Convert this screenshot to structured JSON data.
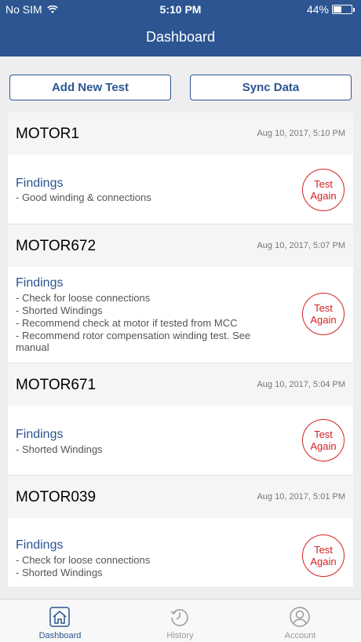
{
  "status": {
    "carrier": "No SIM",
    "time": "5:10 PM",
    "battery": "44%",
    "battery_level": 0.44
  },
  "header": {
    "title": "Dashboard"
  },
  "actions": {
    "add_label": "Add New Test",
    "sync_label": "Sync Data"
  },
  "findings_label": "Findings",
  "test_again": [
    "Test",
    "Again"
  ],
  "motors": [
    {
      "name": "MOTOR1",
      "date": "Aug 10, 2017, 5:10 PM",
      "findings": [
        "- Good winding & connections"
      ]
    },
    {
      "name": "MOTOR672",
      "date": "Aug 10, 2017, 5:07 PM",
      "findings": [
        "- Check for loose connections",
        "- Shorted Windings",
        "- Recommend check at motor if tested from MCC",
        "- Recommend rotor compensation winding test. See",
        "manual"
      ]
    },
    {
      "name": "MOTOR671",
      "date": "Aug 10, 2017, 5:04 PM",
      "findings": [
        "- Shorted Windings"
      ]
    },
    {
      "name": "MOTOR039",
      "date": "Aug 10, 2017, 5:01 PM",
      "findings": [
        "- Check for loose connections",
        "- Shorted Windings"
      ]
    }
  ],
  "tabs": [
    {
      "label": "Dashboard",
      "icon": "home-icon",
      "active": true
    },
    {
      "label": "History",
      "icon": "history-icon",
      "active": false
    },
    {
      "label": "Account",
      "icon": "account-icon",
      "active": false
    }
  ],
  "colors": {
    "primary": "#2c5591",
    "alert": "#d32222"
  }
}
